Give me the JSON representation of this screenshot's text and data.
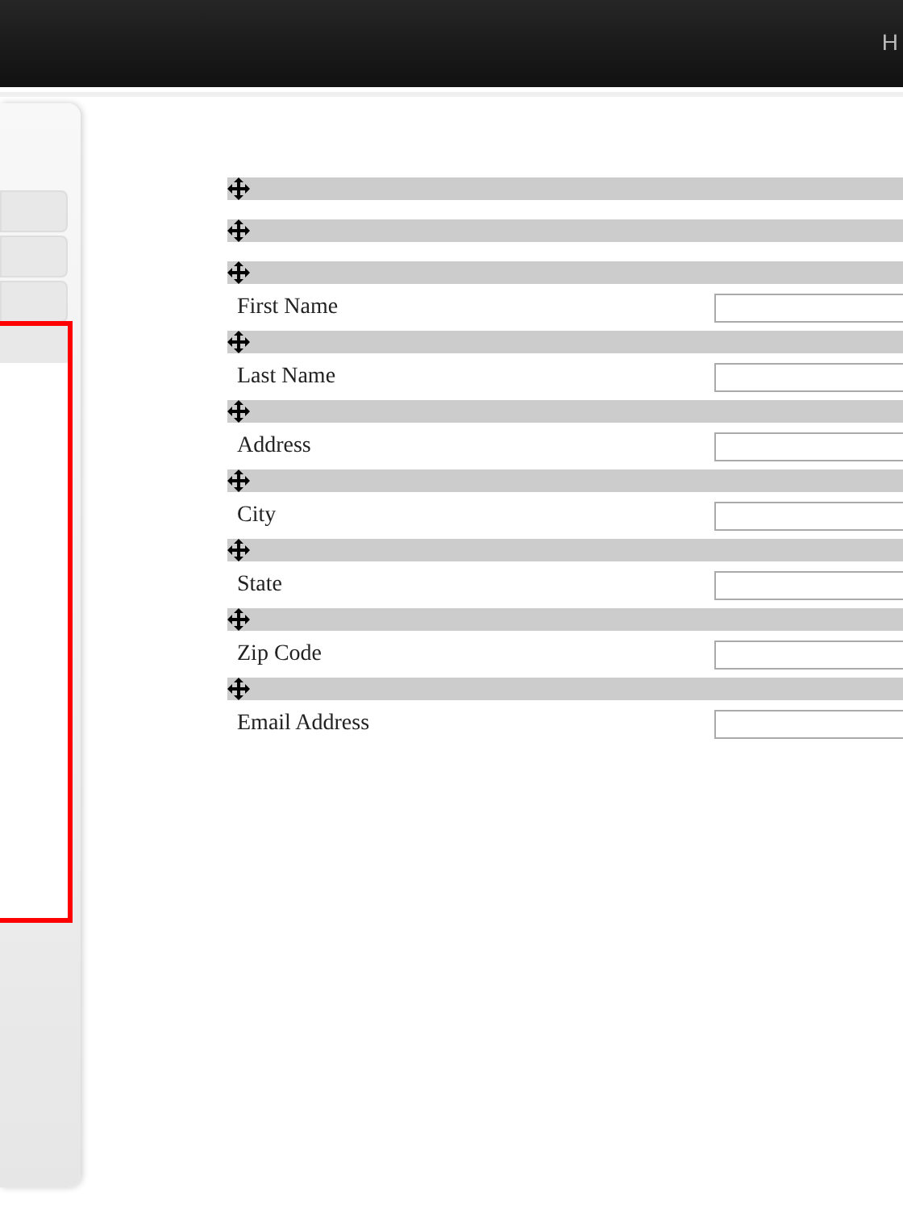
{
  "top_bar": {
    "text": "H"
  },
  "form": {
    "fields": [
      {
        "label": "First Name"
      },
      {
        "label": "Last Name"
      },
      {
        "label": "Address"
      },
      {
        "label": "City"
      },
      {
        "label": "State"
      },
      {
        "label": "Zip Code"
      },
      {
        "label": "Email Address"
      }
    ]
  }
}
